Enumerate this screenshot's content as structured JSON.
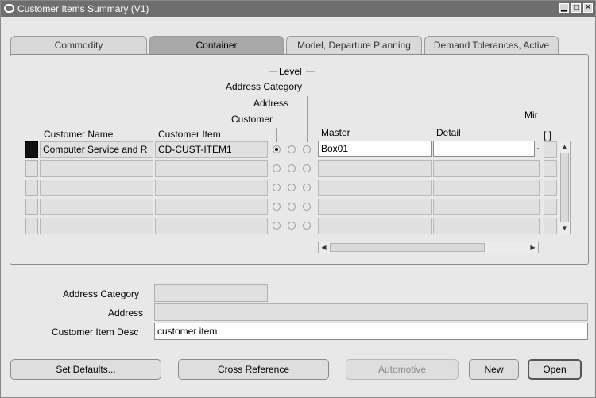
{
  "window": {
    "title": "Customer Items Summary (V1)"
  },
  "tabs": [
    {
      "label": "Commodity",
      "active": false
    },
    {
      "label": "Container",
      "active": true
    },
    {
      "label": "Model, Departure Planning",
      "active": false
    },
    {
      "label": "Demand Tolerances, Active",
      "active": false
    }
  ],
  "level": {
    "group_label": "Level",
    "address_category_label": "Address Category",
    "address_label": "Address",
    "customer_label": "Customer"
  },
  "columns": {
    "customer_name": "Customer Name",
    "customer_item": "Customer Item",
    "master": "Master",
    "detail": "Detail",
    "min_label": "Mir",
    "min_bracket": "[ ]"
  },
  "rows": [
    {
      "customer_name": "Computer Service and R",
      "customer_item": "CD-CUST-ITEM1",
      "master": "Box01",
      "detail": "",
      "level": "customer"
    },
    {
      "customer_name": "",
      "customer_item": "",
      "master": "",
      "detail": "",
      "level": ""
    },
    {
      "customer_name": "",
      "customer_item": "",
      "master": "",
      "detail": "",
      "level": ""
    },
    {
      "customer_name": "",
      "customer_item": "",
      "master": "",
      "detail": "",
      "level": ""
    },
    {
      "customer_name": "",
      "customer_item": "",
      "master": "",
      "detail": "",
      "level": ""
    }
  ],
  "detail_fields": {
    "address_category_label": "Address Category",
    "address_category_value": "",
    "address_label": "Address",
    "address_value": "",
    "desc_label": "Customer Item Desc",
    "desc_value": "customer item"
  },
  "buttons": {
    "set_defaults": "Set Defaults...",
    "cross_reference": "Cross Reference",
    "automotive": "Automotive",
    "new": "New",
    "open": "Open"
  }
}
